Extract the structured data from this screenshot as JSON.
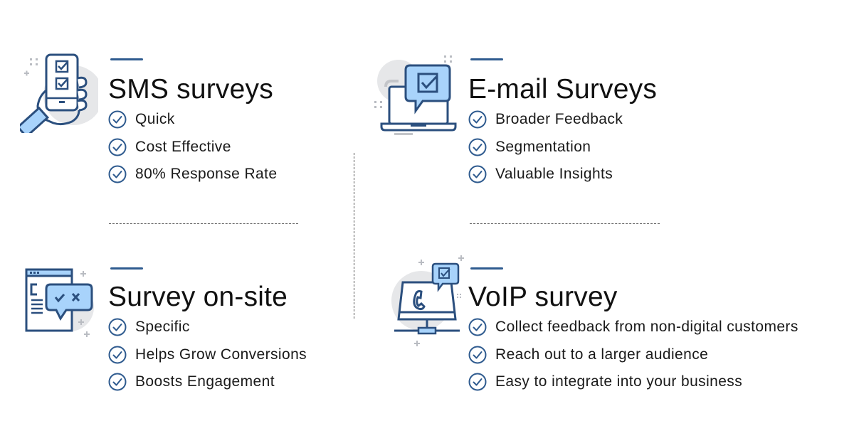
{
  "colors": {
    "accent": "#2f5b8f",
    "icon_stroke": "#2b4f7e",
    "icon_fill": "#a8d3fb",
    "circle_bg": "#e6e7e9",
    "text": "#1a1a1a"
  },
  "sections": [
    {
      "id": "sms",
      "title": "SMS surveys",
      "icon": "hand-holding-phone-checklist-icon",
      "items": [
        "Quick",
        "Cost Effective",
        "80% Response Rate"
      ]
    },
    {
      "id": "email",
      "title": "E-mail Surveys",
      "icon": "laptop-chat-checkbox-icon",
      "items": [
        "Broader Feedback",
        "Segmentation",
        "Valuable Insights"
      ]
    },
    {
      "id": "onsite",
      "title": "Survey on-site",
      "icon": "webpage-chat-check-cross-icon",
      "items": [
        "Specific",
        "Helps Grow Conversions",
        "Boosts Engagement"
      ]
    },
    {
      "id": "voip",
      "title": "VoIP survey",
      "icon": "monitor-phone-network-icon",
      "items": [
        "Collect feedback from non-digital customers",
        "Reach out to a larger audience",
        "Easy to integrate into your business"
      ]
    }
  ],
  "check_icon": "circle-check-icon"
}
